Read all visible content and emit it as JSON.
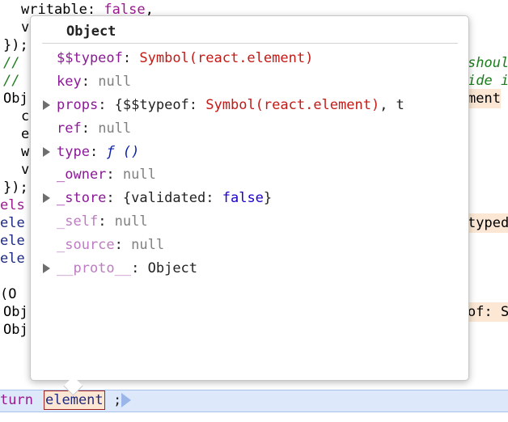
{
  "code_behind": {
    "line1": {
      "prop": "writable",
      "colon": ": ",
      "value": "false",
      "comma": ","
    },
    "line2": "v",
    "line3": "});",
    "line4": "//",
    "line4_right": "shoul",
    "line5": "//",
    "line5_right": "ide i",
    "line6": "Obj",
    "line6_right": "ment",
    "line7": "c",
    "line8": "e",
    "line9": "w",
    "line10": "v",
    "line11": "});",
    "line12": "els",
    "line13": "ele",
    "line13_right": "typed",
    "line14": "ele",
    "line15": "ele",
    "line16": "(O",
    "line17": "Obj",
    "line17_right": "of: S",
    "line18": "Obj",
    "return_line": {
      "keyword": "turn",
      "variable": "element",
      "semicolon": ";"
    }
  },
  "popover": {
    "title": "Object",
    "props": [
      {
        "key": "$$typeof",
        "sep": ": ",
        "value": "Symbol(react.element)",
        "expandable": false,
        "dim": false
      },
      {
        "key": "key",
        "sep": ": ",
        "value": "null",
        "expandable": false,
        "dim": false
      },
      {
        "key": "props",
        "sep": ": ",
        "value_pre": "{$$typeof: ",
        "value_sym": "Symbol(react.element)",
        "value_post": ", t",
        "expandable": true,
        "dim": false
      },
      {
        "key": "ref",
        "sep": ": ",
        "value": "null",
        "expandable": false,
        "dim": false
      },
      {
        "key": "type",
        "sep": ": ",
        "value": "ƒ ()",
        "expandable": true,
        "dim": false
      },
      {
        "key": "_owner",
        "sep": ": ",
        "value": "null",
        "expandable": false,
        "dim": false
      },
      {
        "key": "_store",
        "sep": ": ",
        "value_pre": "{validated: ",
        "value_bool": "false",
        "value_post": "}",
        "expandable": true,
        "dim": false
      },
      {
        "key": "_self",
        "sep": ": ",
        "value": "null",
        "expandable": false,
        "dim": true
      },
      {
        "key": "_source",
        "sep": ": ",
        "value": "null",
        "expandable": false,
        "dim": true
      },
      {
        "key": "__proto__",
        "sep": ": ",
        "value": "Object",
        "expandable": true,
        "dim": true
      }
    ]
  },
  "colors": {
    "keyword": "#9a1a8f",
    "comment": "#1d7c1d",
    "symbol": "#c41a16",
    "prop_key": "#8a1a95",
    "null": "#808080",
    "highlight": "#fbe7d4",
    "exec_line": "#dde8fb"
  }
}
